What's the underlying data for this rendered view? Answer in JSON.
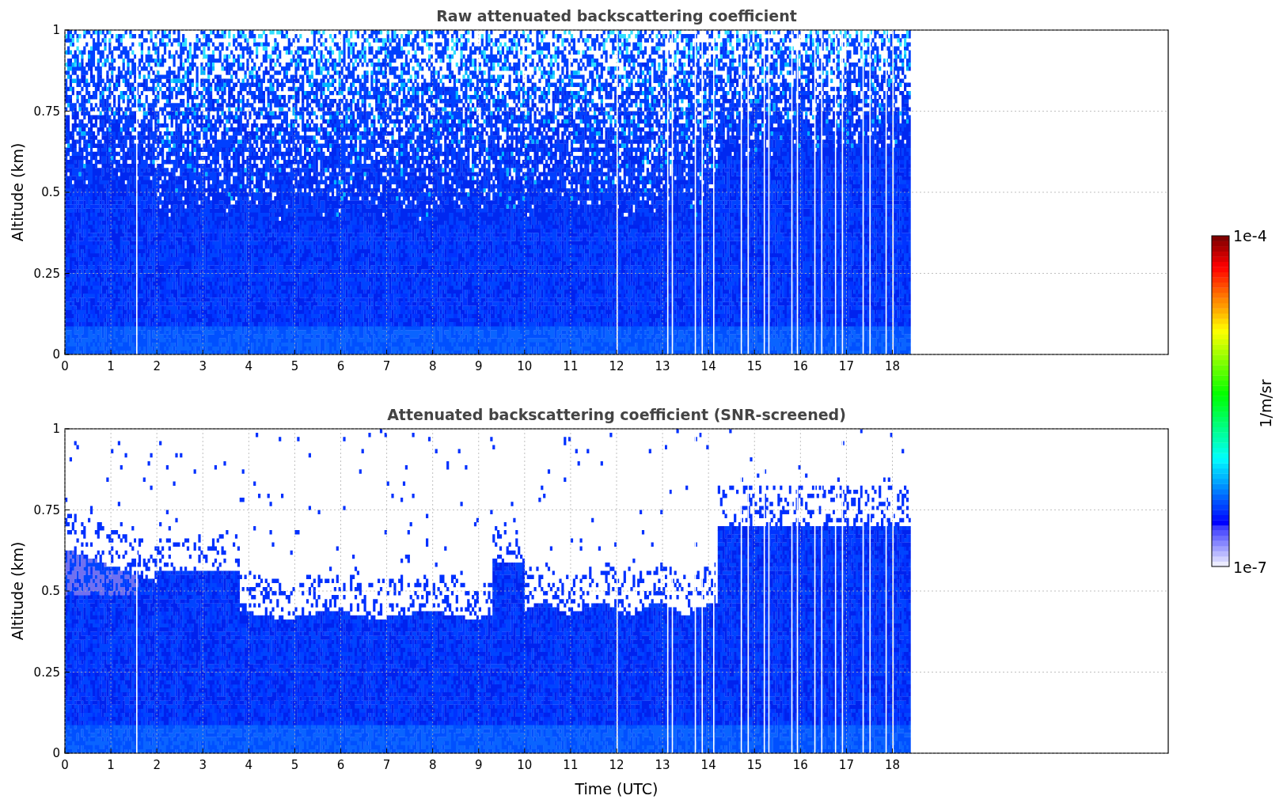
{
  "panels": [
    {
      "kind": "raw",
      "title": "Raw attenuated backscattering coefficient",
      "ylabel": "Altitude (km)",
      "yticks": [
        "1",
        "0.75",
        "0.5",
        "0.25",
        "0"
      ],
      "xticks": [
        "0",
        "1",
        "2",
        "3",
        "4",
        "5",
        "6",
        "7",
        "8",
        "9",
        "10",
        "11",
        "12",
        "13",
        "14",
        "15",
        "16",
        "17",
        "18"
      ]
    },
    {
      "kind": "screened",
      "title": "Attenuated backscattering coefficient (SNR-screened)",
      "ylabel": "Altitude (km)",
      "yticks": [
        "1",
        "0.75",
        "0.5",
        "0.25",
        "0"
      ],
      "xticks": [
        "0",
        "1",
        "2",
        "3",
        "4",
        "5",
        "6",
        "7",
        "8",
        "9",
        "10",
        "11",
        "12",
        "13",
        "14",
        "15",
        "16",
        "17",
        "18"
      ],
      "xlabel": "Time (UTC)"
    }
  ],
  "colorbar": {
    "max_label": "1e-4",
    "min_label": "1e-7",
    "label": "1/m/sr"
  }
}
